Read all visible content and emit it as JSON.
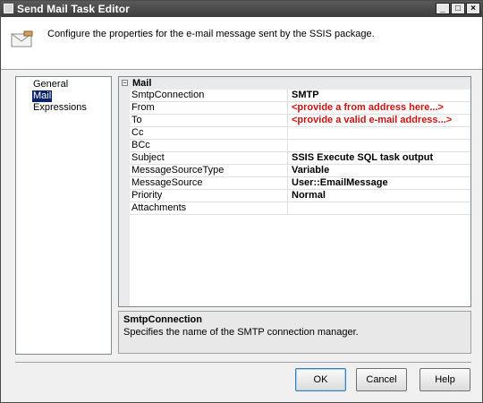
{
  "window": {
    "title": "Send Mail Task Editor"
  },
  "header": {
    "description": "Configure the properties for the e-mail message sent by the SSIS package."
  },
  "nav": {
    "items": [
      {
        "label": "General",
        "selected": false
      },
      {
        "label": "Mail",
        "selected": true
      },
      {
        "label": "Expressions",
        "selected": false
      }
    ]
  },
  "grid": {
    "category": "Mail",
    "rows": [
      {
        "name": "SmtpConnection",
        "value": "SMTP"
      },
      {
        "name": "From",
        "value": "<provide a from address here...>"
      },
      {
        "name": "To",
        "value": "<provide a valid e-mail address...>"
      },
      {
        "name": "Cc",
        "value": ""
      },
      {
        "name": "BCc",
        "value": ""
      },
      {
        "name": "Subject",
        "value": "SSIS Execute SQL task output"
      },
      {
        "name": "MessageSourceType",
        "value": "Variable"
      },
      {
        "name": "MessageSource",
        "value": "User::EmailMessage"
      },
      {
        "name": "Priority",
        "value": "Normal"
      },
      {
        "name": "Attachments",
        "value": ""
      }
    ]
  },
  "description": {
    "title": "SmtpConnection",
    "text": "Specifies the name of the SMTP connection manager."
  },
  "buttons": {
    "ok": "OK",
    "cancel": "Cancel",
    "help": "Help"
  },
  "colors": {
    "warning_text": "#d01010",
    "selection": "#0a246a"
  }
}
